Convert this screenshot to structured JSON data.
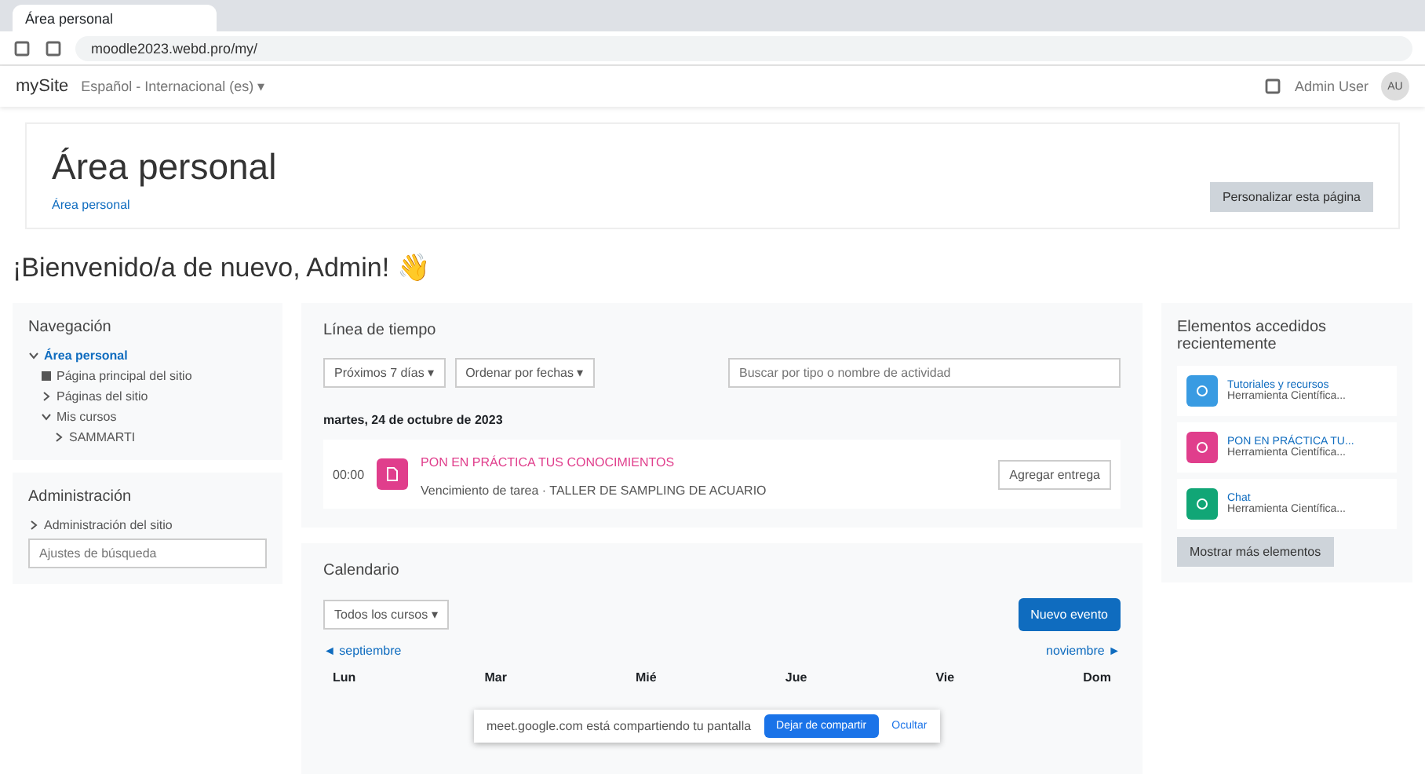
{
  "browser": {
    "tab_title": "Área personal",
    "url": "moodle2023.webd.pro/my/"
  },
  "navbar": {
    "brand": "mySite",
    "language": "Español - Internacional (es) ▾",
    "user": "Admin User",
    "avatar": "AU"
  },
  "header": {
    "title": "Área personal",
    "breadcrumb": "Área personal",
    "customize_button": "Personalizar esta página"
  },
  "welcome": "¡Bienvenido/a de nuevo, Admin! 👋",
  "navigation": {
    "title": "Navegación",
    "items": [
      {
        "label": "Área personal",
        "selected": true,
        "expanded": true,
        "children": [
          {
            "label": "Página principal del sitio",
            "selected": false,
            "kind": "home"
          },
          {
            "label": "Páginas del sitio",
            "selected": false,
            "expanded": false
          },
          {
            "label": "Mis cursos",
            "selected": false,
            "expanded": true,
            "children": [
              {
                "label": "SAMMARTI",
                "selected": false,
                "expanded": false
              }
            ]
          }
        ]
      }
    ]
  },
  "administration": {
    "title": "Administración",
    "items": [
      {
        "label": "Administración del sitio",
        "expanded": false
      }
    ],
    "search": {
      "placeholder": "Ajustes de búsqueda"
    }
  },
  "timeline": {
    "title": "Línea de tiempo",
    "filter": "Próximos 7 días ▾",
    "sort": "Ordenar por fechas ▾",
    "search": {
      "placeholder": "Buscar por tipo o nombre de actividad"
    },
    "date": "martes, 24 de octubre de 2023",
    "events": [
      {
        "time": "00:00",
        "title": "PON EN PRÁCTICA TUS CONOCIMIENTOS",
        "subtitle": "Vencimiento de tarea · TALLER DE SAMPLING DE ACUARIO",
        "action": "Agregar entrega",
        "color": "#e03e8c"
      }
    ]
  },
  "calendar": {
    "title": "Calendario",
    "course_filter": "Todos los cursos ▾",
    "new_event": "Nuevo evento",
    "prev": "◄ septiembre",
    "next": "noviembre ►",
    "days": [
      "Lun",
      "Mar",
      "Mié",
      "Jue",
      "Vie",
      "Dom"
    ]
  },
  "sharing_bar": {
    "message": "meet.google.com está compartiendo tu pantalla",
    "stop": "Dejar de compartir",
    "hide": "Ocultar"
  },
  "recent": {
    "title": "Elementos accedidos recientemente",
    "items": [
      {
        "name": "Tutoriales y recursos",
        "course": "Herramienta Científica...",
        "color": "#399be2"
      },
      {
        "name": "PON EN PRÁCTICA TU...",
        "course": "Herramienta Científica...",
        "color": "#e03e8c"
      },
      {
        "name": "Chat",
        "course": "Herramienta Científica...",
        "color": "#11a676"
      }
    ],
    "more": "Mostrar más elementos"
  }
}
